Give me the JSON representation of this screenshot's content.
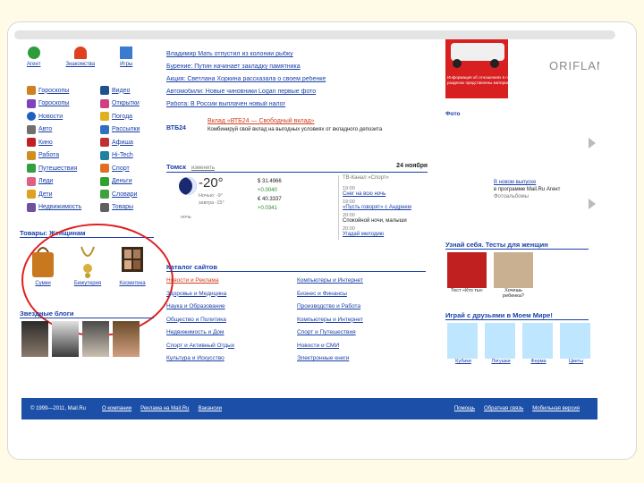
{
  "top_icons": [
    {
      "label": "Агент",
      "icon": "agent-icon",
      "color": "#2e9c3a"
    },
    {
      "label": "Знакомства",
      "icon": "heart-icon",
      "color": "#e04020"
    },
    {
      "label": "Игры",
      "icon": "cube-icon",
      "color": "#3a7ad0"
    }
  ],
  "left_col1": [
    {
      "label": "Гороскопы",
      "icon": "stars-icon",
      "color": "#d08020"
    },
    {
      "label": "Гороскопы",
      "icon": "zodiac-icon",
      "color": "#8040c0"
    },
    {
      "label": "Новости",
      "icon": "globe-icon",
      "color": "#2060c0"
    },
    {
      "label": "Авто",
      "icon": "car-icon",
      "color": "#707070"
    },
    {
      "label": "Кино",
      "icon": "film-icon",
      "color": "#c02020"
    },
    {
      "label": "Работа",
      "icon": "work-icon",
      "color": "#d09020"
    },
    {
      "label": "Путешествия",
      "icon": "palm-icon",
      "color": "#30a040"
    },
    {
      "label": "Леди",
      "icon": "lady-icon",
      "color": "#e06080"
    },
    {
      "label": "Дети",
      "icon": "kids-icon",
      "color": "#e0a020"
    },
    {
      "label": "Недвижимость",
      "icon": "house-icon",
      "color": "#7050a0"
    }
  ],
  "left_col2": [
    {
      "label": "Видео",
      "icon": "video-icon",
      "color": "#205090"
    },
    {
      "label": "Открытки",
      "icon": "card-icon",
      "color": "#d04080"
    },
    {
      "label": "Погода",
      "icon": "weather-icon",
      "color": "#e0b020"
    },
    {
      "label": "Рассылки",
      "icon": "mail-icon",
      "color": "#3070c0"
    },
    {
      "label": "Афиша",
      "icon": "poster-icon",
      "color": "#c03030"
    },
    {
      "label": "Hi-Tech",
      "icon": "hitech-icon",
      "color": "#2080a0"
    },
    {
      "label": "Спорт",
      "icon": "sport-icon",
      "color": "#e07020"
    },
    {
      "label": "Деньги",
      "icon": "money-icon",
      "color": "#30a030"
    },
    {
      "label": "Словари",
      "icon": "book-icon",
      "color": "#40a040"
    },
    {
      "label": "Товары",
      "icon": "cart-icon",
      "color": "#606060"
    }
  ],
  "goods": {
    "title": "Товары: Женщинам",
    "items": [
      {
        "label": "Сумки",
        "icon": "bag-icon"
      },
      {
        "label": "Бижутерия",
        "icon": "necklace-icon"
      },
      {
        "label": "Косметика",
        "icon": "palette-icon"
      }
    ]
  },
  "blogs": {
    "title": "Звездные блоги"
  },
  "news_lines": [
    "Владимир Мать отпустил из колонии рыбку",
    "Бурение: Путин начинает закладку памятника",
    "Акция: Светлана Хоркина рассказала о своем ребенке",
    "Автомобили: Новые чиновники Logan первые фото",
    "Работа: В России выплачен новый налог"
  ],
  "vtb": {
    "logo": "ВТБ24",
    "title": "Вклад «ВТБ24 — Свободный вклад»",
    "desc": "Комбинируй свой вклад на выгодных условиях от вкладного депозита"
  },
  "weather": {
    "city": "Томск",
    "change": "изменить",
    "date": "24 ноября",
    "temp": "-20°",
    "temp_small": "Ночью: -9°",
    "tomorrow": "завтра -15°",
    "label_now": "ночь",
    "rates": [
      "$ 31.4966",
      "+0.0040",
      "€ 40.3337",
      "+0.0341"
    ]
  },
  "tv": {
    "channel": "ТВ-Канал «Спорт»",
    "items": [
      {
        "time": "19:00",
        "title": "Снег на всю ночь"
      },
      {
        "time": "19:00",
        "title": "«Пусть говорят» с Андреем"
      },
      {
        "time": "20:00",
        "title": "Спокойной ночи, малыши"
      },
      {
        "time": "20:00",
        "title": "Угадай мелодию"
      }
    ]
  },
  "catalog": {
    "title": "Каталог сайтов",
    "col1": [
      "Новости и Реклама",
      "Здоровье и Медицина",
      "Наука и Образование",
      "Общество и Политика",
      "Недвижимость и Дом",
      "Спорт и Активный Отдых",
      "Культура и Искусство"
    ],
    "col2": [
      "Компьютеры и Интернет",
      "Бизнес и Финансы",
      "Производство и Работа",
      "Компьютеры и Интернет",
      "Спорт и Путешествия",
      "Новости и СМИ",
      "Электронные книги"
    ]
  },
  "ad": {
    "brand": "ORIFLAME",
    "caption": "Информация об отношениях в городе в следующих разделах представлены материалы"
  },
  "photo": {
    "label": "Фото"
  },
  "right_mid": {
    "title": "В новом выпуске",
    "sub": "в программе Mail.Ru Агент",
    "extra": "Фотоальбомы"
  },
  "tests": {
    "title": "Узнай себя. Тесты для женщин",
    "items": [
      {
        "label": "Тест «Кто ты»",
        "icon": "mask-icon"
      },
      {
        "label": "Хочешь ребенка?",
        "icon": "child-icon"
      }
    ]
  },
  "games": {
    "title": "Играй с друзьями в Моем Мире!",
    "items": [
      {
        "label": "Кубики",
        "icon": "duck-icon"
      },
      {
        "label": "Лягушки",
        "icon": "frog-icon"
      },
      {
        "label": "Ферма",
        "icon": "swan-icon"
      },
      {
        "label": "Цветы",
        "icon": "flower-icon"
      }
    ]
  },
  "footer": {
    "copyright": "© 1999—2011, Mail.Ru",
    "links": [
      "О компании",
      "Реклама на Mail.Ru",
      "Вакансии"
    ],
    "right": [
      "Помощь",
      "Обратная связь",
      "Мобильная версия"
    ]
  }
}
